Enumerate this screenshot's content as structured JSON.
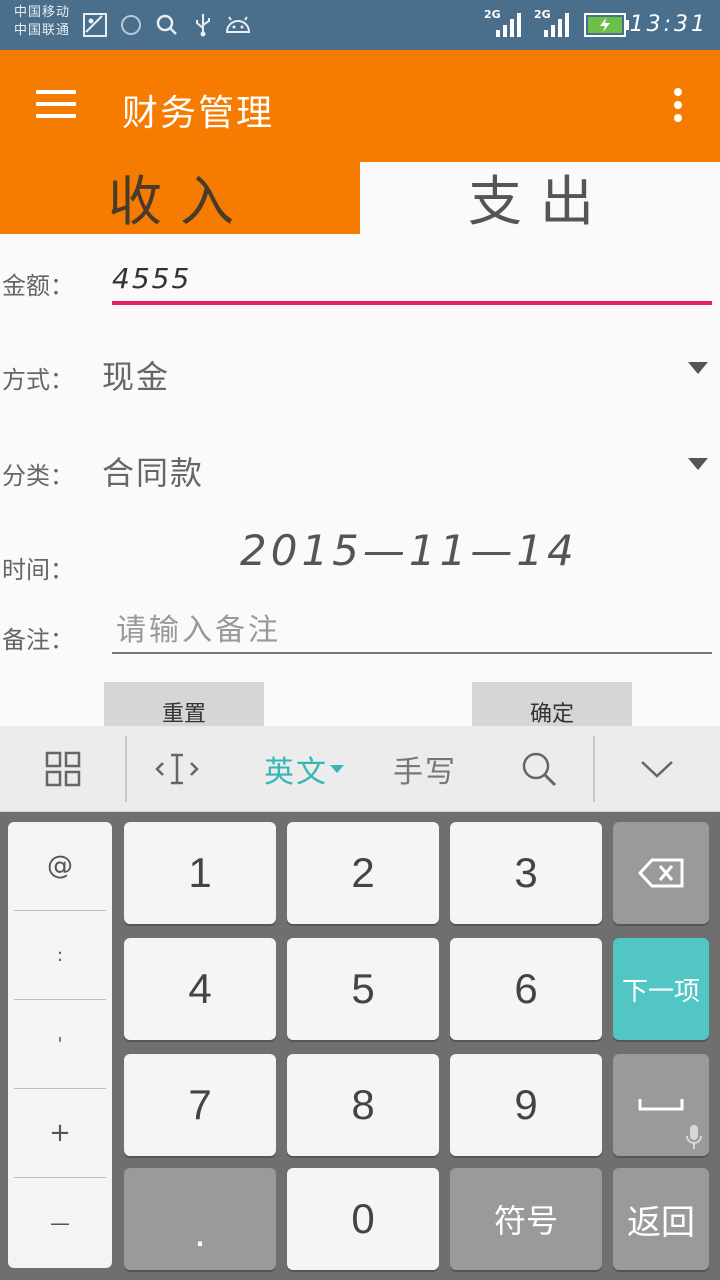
{
  "status_bar": {
    "carrier_1": "中国移动",
    "carrier_2": "中国联通",
    "network_1": "2G",
    "network_2": "2G",
    "time": "13:31"
  },
  "app_bar": {
    "title": "财务管理",
    "menu_icon": "hamburger-menu-icon",
    "overflow_icon": "more-vert-icon"
  },
  "tabs": [
    {
      "label": "收入",
      "selected": true
    },
    {
      "label": "支出",
      "selected": false
    }
  ],
  "form": {
    "amount_label": "金额：",
    "amount_value": "4555",
    "method_label": "方式：",
    "method_value": "现金",
    "category_label": "分类：",
    "category_value": "合同款",
    "time_label": "时间：",
    "time_value": "2015—11—14",
    "note_label": "备注：",
    "note_placeholder": "请输入备注",
    "reset_button": "重置",
    "confirm_button": "确定"
  },
  "keyboard_toolbar": {
    "grid_icon": "grid-icon",
    "cursor_icon": "cursor-move-icon",
    "language": "英文",
    "handwriting": "手写",
    "search_icon": "search-icon",
    "collapse_icon": "chevron-down-icon"
  },
  "keyboard": {
    "side_keys": [
      "@",
      ":",
      "'",
      "+",
      "—"
    ],
    "digits": [
      "1",
      "2",
      "3",
      "4",
      "5",
      "6",
      "7",
      "8",
      "9",
      "0"
    ],
    "dot": ".",
    "symbols": "符号",
    "next": "下一项",
    "back": "返回",
    "accent_color": "#52c6c5"
  },
  "colors": {
    "primary": "#f57c00",
    "status_bar": "#4a6f8c",
    "amount_underline": "#e91e63"
  }
}
